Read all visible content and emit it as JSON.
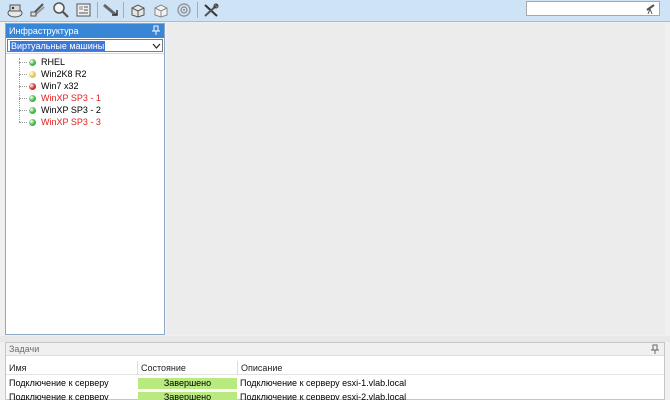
{
  "toolbar": {
    "buttons": [
      {
        "icon": "connect-server-icon"
      },
      {
        "icon": "disconnect-icon"
      },
      {
        "icon": "search-magnifier-icon"
      },
      {
        "icon": "properties-icon"
      },
      {
        "icon": "migrate-icon"
      },
      {
        "icon": "deploy-vm-icon"
      },
      {
        "icon": "package-icon"
      },
      {
        "icon": "target-icon"
      },
      {
        "icon": "tools-icon"
      }
    ],
    "search": {
      "value": "",
      "placeholder": ""
    }
  },
  "infrastructure": {
    "title": "Инфраструктура",
    "view_selector": {
      "selected": "Виртуальные машины"
    },
    "tree": [
      {
        "label": "RHEL",
        "status_color": "#3fb33f",
        "label_color": "#000000"
      },
      {
        "label": "Win2K8 R2",
        "status_color": "#d6c85a",
        "label_color": "#000000"
      },
      {
        "label": "Win7 x32",
        "status_color": "#c92b2b",
        "label_color": "#000000"
      },
      {
        "label": "WinXP SP3 - 1",
        "status_color": "#3fb33f",
        "label_color": "#e02020"
      },
      {
        "label": "WinXP SP3 - 2",
        "status_color": "#3fb33f",
        "label_color": "#000000"
      },
      {
        "label": "WinXP SP3 - 3",
        "status_color": "#3fb33f",
        "label_color": "#e02020"
      }
    ]
  },
  "tasks": {
    "title": "Задачи",
    "columns": [
      "Имя",
      "Состояние",
      "Описание"
    ],
    "rows": [
      {
        "name": "Подключение к серверу",
        "status": "Завершено",
        "description": "Подключение к серверу esxi-1.vlab.local"
      },
      {
        "name": "Подключение к серверу",
        "status": "Завершено",
        "description": "Подключение к серверу esxi-2.vlab.local"
      }
    ]
  },
  "colors": {
    "panel_header": "#3a86d6",
    "status_complete": "#b8ea7f"
  }
}
